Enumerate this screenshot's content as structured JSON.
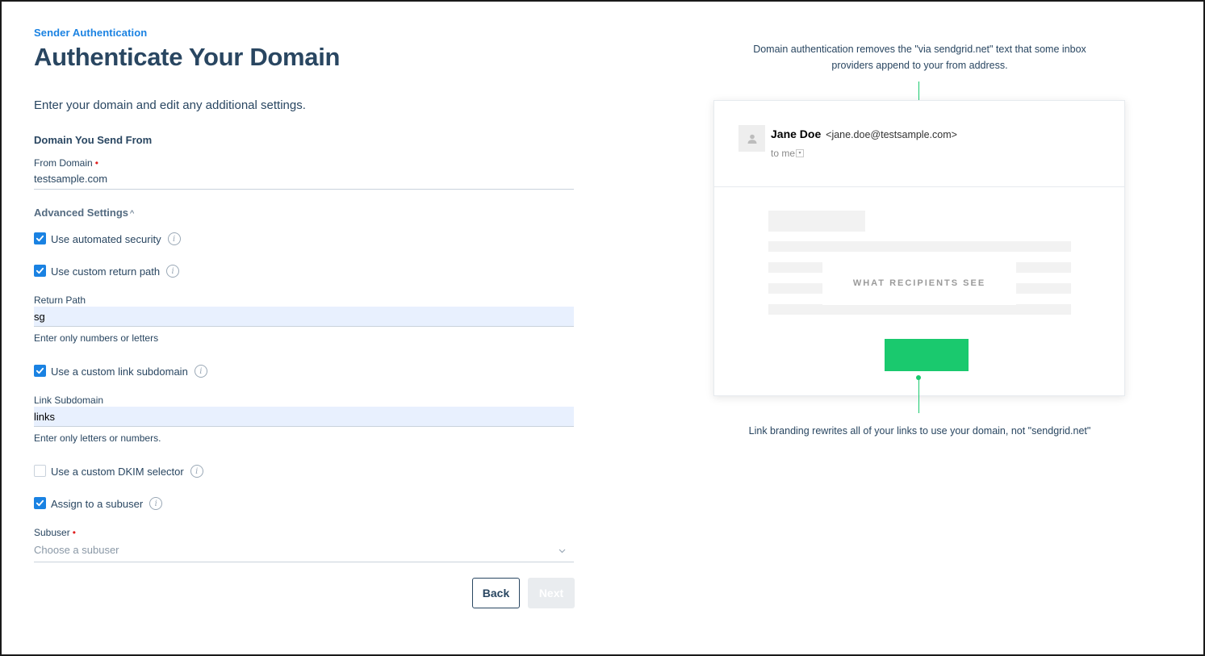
{
  "header": {
    "eyebrow": "Sender Authentication",
    "title": "Authenticate Your Domain",
    "intro": "Enter your domain and edit any additional settings."
  },
  "domain_section": {
    "title": "Domain You Send From",
    "from_domain_label": "From Domain",
    "required_mark": "•",
    "from_domain_value": "testsample.com"
  },
  "advanced": {
    "label": "Advanced Settings",
    "caret": "^",
    "options": [
      {
        "label": "Use automated security",
        "checked": true
      },
      {
        "label": "Use custom return path",
        "checked": true
      },
      {
        "label": "Use a custom link subdomain",
        "checked": true
      },
      {
        "label": "Use a custom DKIM selector",
        "checked": false
      },
      {
        "label": "Assign to a subuser",
        "checked": true
      }
    ],
    "info_glyph": "i"
  },
  "return_path": {
    "label": "Return Path",
    "value": "sg",
    "help": "Enter only numbers or letters"
  },
  "link_subdomain": {
    "label": "Link Subdomain",
    "value": "links",
    "help": "Enter only letters or numbers."
  },
  "subuser": {
    "label": "Subuser",
    "required_mark": "•",
    "placeholder": "Choose a subuser"
  },
  "buttons": {
    "back": "Back",
    "next": "Next"
  },
  "preview": {
    "top_caption_line1": "Domain authentication removes the \"via sendgrid.net\" text that some inbox",
    "top_caption_line2": "providers append to your from address.",
    "sender_name": "Jane Doe",
    "sender_email": "<jane.doe@testsample.com>",
    "to_me": "to me",
    "center_label": "WHAT RECIPIENTS SEE",
    "bottom_caption": "Link branding rewrites all of your links to use your domain, not \"sendgrid.net\""
  },
  "icons": {
    "checkbox_checked": "check-icon",
    "info": "info-icon",
    "chevron": "chevron-down-icon",
    "avatar": "person-icon"
  },
  "colors": {
    "brand_blue": "#1a82e2",
    "heading": "#294661",
    "accent_green": "#1ac96e",
    "filled_input": "#e8f0fe"
  }
}
